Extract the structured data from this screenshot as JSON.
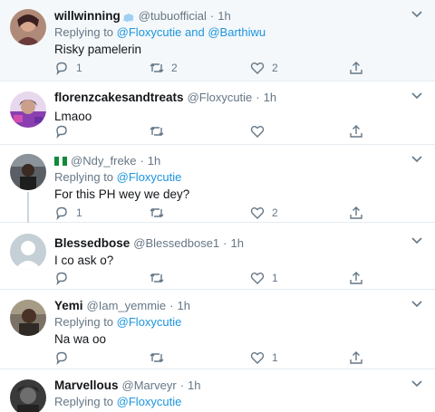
{
  "tweets": [
    {
      "name": "willwinning",
      "handle": "@tubuofficial",
      "time": "1h",
      "replying_prefix": "Replying to",
      "replying_to_1": "@Floxycutie",
      "replying_and": "and",
      "replying_to_2": "@Barthiwu",
      "text": "Risky pamelerin",
      "reply_count": "1",
      "retweet_count": "2",
      "like_count": "2"
    },
    {
      "name": "florenzcakesandtreats",
      "handle": "@Floxycutie",
      "time": "1h",
      "text": "Lmaoo"
    },
    {
      "name": "",
      "handle": "@Ndy_freke",
      "time": "1h",
      "replying_prefix": "Replying to",
      "replying_to_1": "@Floxycutie",
      "text": "For this PH wey we dey?",
      "reply_count": "1",
      "like_count": "2"
    },
    {
      "name": "Blessedbose",
      "handle": "@Blessedbose1",
      "time": "1h",
      "text": "I co ask o?",
      "like_count": "1"
    },
    {
      "name": "Yemi",
      "handle": "@Iam_yemmie",
      "time": "1h",
      "replying_prefix": "Replying to",
      "replying_to_1": "@Floxycutie",
      "text": "Na wa oo",
      "like_count": "1"
    },
    {
      "name": "Marvellous",
      "handle": "@Marveyr",
      "time": "1h",
      "replying_prefix": "Replying to",
      "replying_to_1": "@Floxycutie"
    }
  ],
  "separator": "·",
  "colors": {
    "accent": "#1b95e0",
    "muted": "#657786",
    "border": "#e6ecf0",
    "highlight": "#f5f8fa"
  },
  "icons": [
    "reply-icon",
    "retweet-icon",
    "like-icon",
    "share-icon",
    "chevron-down-icon",
    "verified-badge-icon",
    "nigeria-flag-icon"
  ]
}
